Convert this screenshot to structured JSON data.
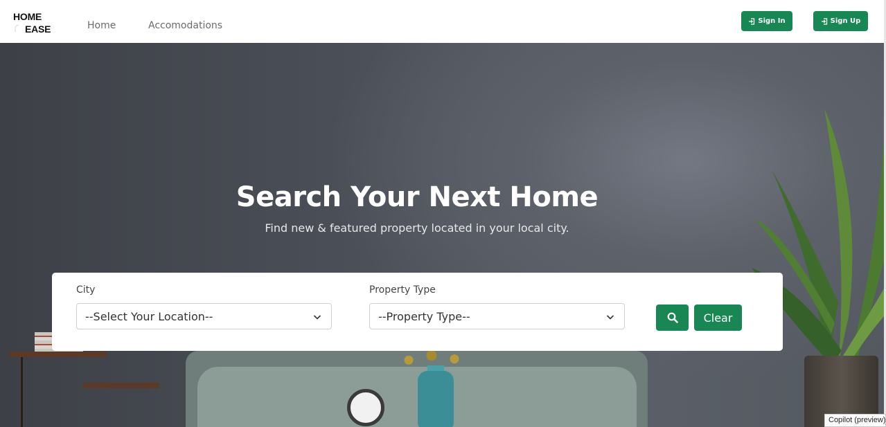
{
  "navbar": {
    "logo_line1": "HOME",
    "logo_line2": "EASE",
    "links": [
      {
        "label": "Home"
      },
      {
        "label": "Accomodations"
      }
    ],
    "sign_in_label": "Sign In",
    "sign_up_label": "Sign Up",
    "sign_in_icon": "sign-in-icon",
    "sign_up_icon": "sign-in-icon"
  },
  "hero": {
    "title": "Search Your Next Home",
    "subtitle": "Find new & featured property located in your local city."
  },
  "search": {
    "city_label": "City",
    "city_selected": "--Select Your Location--",
    "type_label": "Property Type",
    "type_selected": "--Property Type--",
    "search_icon": "search-icon",
    "clear_label": "Clear"
  },
  "overlay": {
    "copilot_label": "Copilot (preview)"
  },
  "colors": {
    "accent": "#198754",
    "nav_link": "#6b6b6b",
    "hero_text": "#ffffff"
  }
}
